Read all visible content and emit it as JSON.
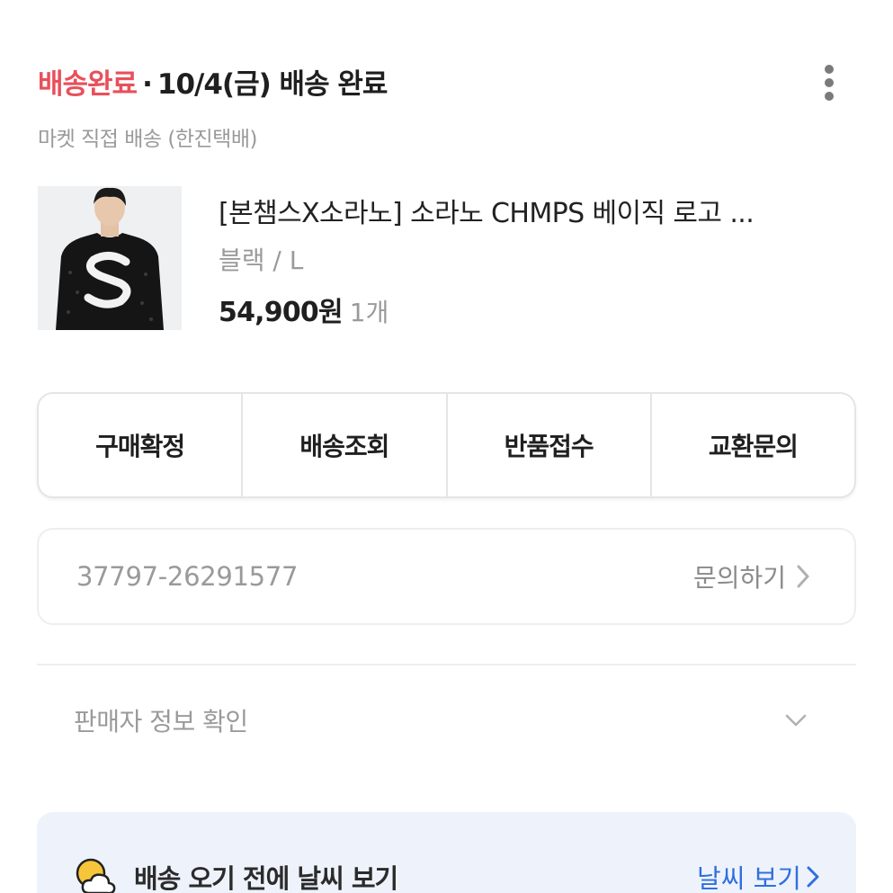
{
  "order": {
    "status": "배송완료",
    "separator": "·",
    "date_text": "10/4(금) 배송 완료",
    "delivery_method": "마켓 직접 배송 (한진택배)"
  },
  "product": {
    "name": "[본챔스X소라노] 소라노 CHMPS 베이직 로고 ...",
    "option": "블랙 / L",
    "price": "54,900원",
    "quantity": "1개"
  },
  "actions": [
    {
      "label": "구매확정"
    },
    {
      "label": "배송조회"
    },
    {
      "label": "반품접수"
    },
    {
      "label": "교환문의"
    }
  ],
  "order_info": {
    "order_number": "37797-26291577",
    "inquiry_label": "문의하기"
  },
  "seller": {
    "label": "판매자 정보 확인"
  },
  "weather": {
    "text": "배송 오기 전에 날씨 보기",
    "link_label": "날씨 보기"
  },
  "colors": {
    "status": "#e8505b",
    "link": "#2f6fe0",
    "banner_bg": "#eef3fb"
  },
  "icons": {
    "more": "more-vertical-icon",
    "chevron_right": "chevron-right-icon",
    "chevron_down": "chevron-down-icon",
    "weather": "sun-cloud-icon"
  }
}
